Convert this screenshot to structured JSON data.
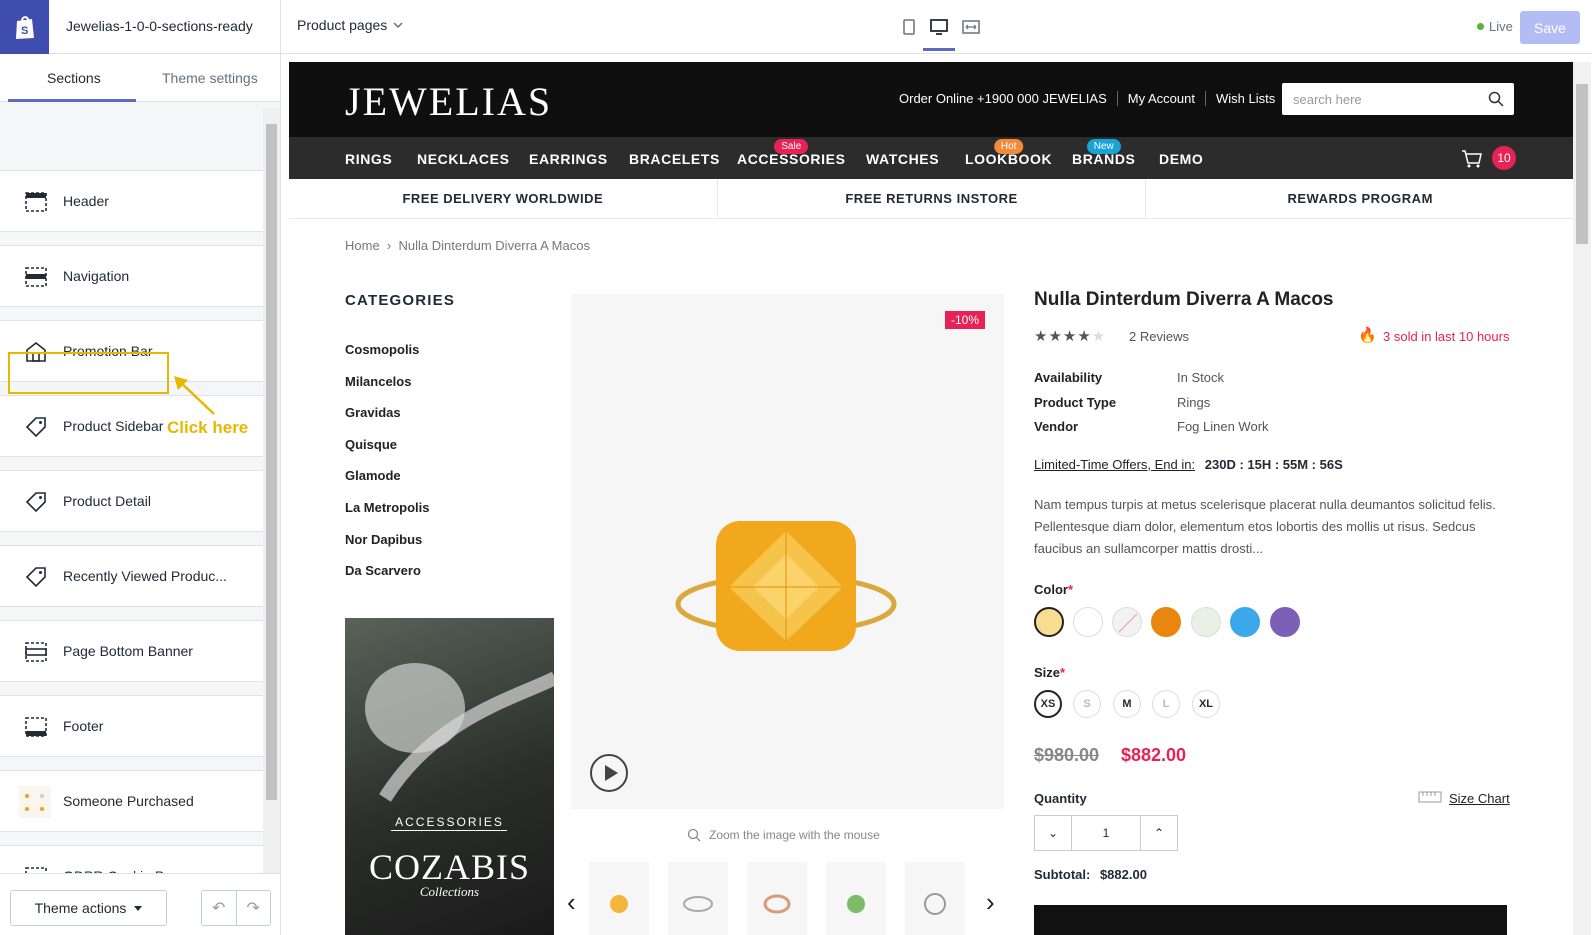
{
  "topbar": {
    "theme_name": "Jewelias-1-0-0-sections-ready",
    "page_select": "Product pages",
    "live_label": "Live",
    "save_label": "Save"
  },
  "sidebar": {
    "tabs": [
      {
        "label": "Sections"
      },
      {
        "label": "Theme settings"
      }
    ],
    "items": [
      {
        "label": "Header",
        "icon": "header-icon"
      },
      {
        "label": "Navigation",
        "icon": "navigation-icon"
      },
      {
        "label": "Promotion Bar",
        "icon": "store-icon"
      },
      {
        "label": "Product Sidebar",
        "icon": "tag-icon"
      },
      {
        "label": "Product Detail",
        "icon": "tag-icon"
      },
      {
        "label": "Recently Viewed Produc...",
        "icon": "tag-icon"
      },
      {
        "label": "Page Bottom Banner",
        "icon": "banner-icon"
      },
      {
        "label": "Footer",
        "icon": "footer-icon"
      },
      {
        "label": "Someone Purchased",
        "icon": "product-thumbnail-icon"
      },
      {
        "label": "GDPR Cookie Popup",
        "icon": "banner-icon"
      }
    ],
    "annotation": "Click here",
    "theme_actions": "Theme actions"
  },
  "store": {
    "brand": "JEWELIAS",
    "top_links": [
      "Order Online +1900 000 JEWELIAS",
      "My Account",
      "Wish Lists"
    ],
    "search_placeholder": "search here",
    "nav": [
      {
        "label": "RINGS",
        "badge": ""
      },
      {
        "label": "NECKLACES",
        "badge": ""
      },
      {
        "label": "EARRINGS",
        "badge": ""
      },
      {
        "label": "BRACELETS",
        "badge": ""
      },
      {
        "label": "ACCESSORIES",
        "badge": "Sale",
        "badge_color": "#e72254"
      },
      {
        "label": "WATCHES",
        "badge": ""
      },
      {
        "label": "LOOKBOOK",
        "badge": "Hot",
        "badge_color": "#f28a3b"
      },
      {
        "label": "BRANDS",
        "badge": "New",
        "badge_color": "#1aa3d6"
      },
      {
        "label": "DEMO",
        "badge": ""
      }
    ],
    "cart_count": "10",
    "promo": [
      "FREE DELIVERY WORLDWIDE",
      "FREE RETURNS INSTORE",
      "REWARDS PROGRAM"
    ],
    "breadcrumb": {
      "home": "Home",
      "current": "Nulla Dinterdum Diverra A Macos"
    },
    "categories_title": "CATEGORIES",
    "categories": [
      "Cosmopolis",
      "Milancelos",
      "Gravidas",
      "Quisque",
      "Glamode",
      "La Metropolis",
      "Nor Dapibus",
      "Da Scarvero"
    ],
    "ad": {
      "label": "ACCESSORIES",
      "title": "COZABIS",
      "subtitle": "Collections"
    },
    "product": {
      "discount": "-10%",
      "zoom_hint": "Zoom the image with the mouse",
      "title": "Nulla Dinterdum Diverra A Macos",
      "rating": 4,
      "reviews": "2 Reviews",
      "sold": "3 sold in last 10 hours",
      "availability_label": "Availability",
      "availability": "In Stock",
      "type_label": "Product Type",
      "type": "Rings",
      "vendor_label": "Vendor",
      "vendor": "Fog Linen Work",
      "offer_label": "Limited-Time Offers, End in:",
      "countdown": "230D : 15H : 55M : 56S",
      "description": "Nam tempus turpis at metus scelerisque placerat nulla deumantos solicitud felis. Pellentesque diam dolor, elementum etos lobortis des mollis ut risus. Sedcus faucibus an sullamcorper mattis drosti...",
      "color_label": "Color",
      "colors": [
        "#f8dc92",
        "#ffffff",
        "#f2f2f2",
        "#e8860f",
        "#e9f1e6",
        "#3aa8ea",
        "#7d5fb8"
      ],
      "size_label": "Size",
      "sizes": [
        "XS",
        "S",
        "M",
        "L",
        "XL"
      ],
      "price_old": "$980.00",
      "price_new": "$882.00",
      "quantity_label": "Quantity",
      "quantity": "1",
      "size_chart": "Size Chart",
      "subtotal_label": "Subtotal:",
      "subtotal": "$882.00"
    }
  }
}
